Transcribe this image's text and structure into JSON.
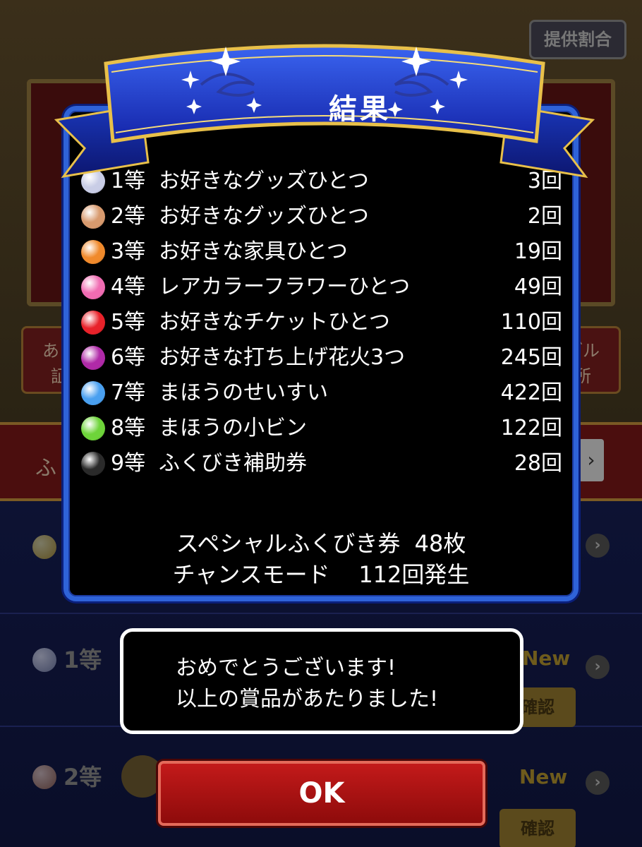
{
  "background": {
    "rate_button": "提供割合",
    "side_left": "あら\n証",
    "side_right": "ブル\n所",
    "band_text": "ふ",
    "band_arrow": "›",
    "list_rows": [
      {
        "rank": "",
        "new": "",
        "confirm": ""
      },
      {
        "rank": "1等",
        "new": "New",
        "confirm": "確認"
      },
      {
        "rank": "2等",
        "new": "New",
        "confirm": "確認"
      }
    ]
  },
  "dialog": {
    "title": "結果",
    "results": [
      {
        "rank": "1等",
        "prize": "お好きなグッズひとつ",
        "count": "3回",
        "orb_color": "#c9cde6"
      },
      {
        "rank": "2等",
        "prize": "お好きなグッズひとつ",
        "count": "2回",
        "orb_color": "#d89a6e"
      },
      {
        "rank": "3等",
        "prize": "お好きな家具ひとつ",
        "count": "19回",
        "orb_color": "#f08a2c"
      },
      {
        "rank": "4等",
        "prize": "レアカラーフラワーひとつ",
        "count": "49回",
        "orb_color": "#f06cb2"
      },
      {
        "rank": "5等",
        "prize": "お好きなチケットひとつ",
        "count": "110回",
        "orb_color": "#e8222a"
      },
      {
        "rank": "6等",
        "prize": "お好きな打ち上げ花火3つ",
        "count": "245回",
        "orb_color": "#b02aa8"
      },
      {
        "rank": "7等",
        "prize": "まほうのせいすい",
        "count": "422回",
        "orb_color": "#4aa0f0"
      },
      {
        "rank": "8等",
        "prize": "まほうの小ビン",
        "count": "122回",
        "orb_color": "#6ed43a"
      },
      {
        "rank": "9等",
        "prize": "ふくびき補助券",
        "count": "28回",
        "orb_color": "#2a2a2a"
      }
    ],
    "summary_line1": "スペシャルふくびき券  48枚",
    "summary_line2": "チャンスモード    112回発生"
  },
  "message": {
    "line1": "おめでとうございます!",
    "line2": "以上の賞品があたりました!"
  },
  "ok_button": "OK",
  "colors": {
    "panel_border": "#2f63d8",
    "ribbon": "#1c3fd0",
    "ribbon_trim": "#e8c04a",
    "ok_button": "#b31515"
  }
}
